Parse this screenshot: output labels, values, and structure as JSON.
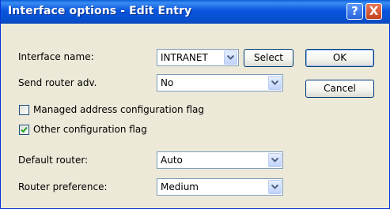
{
  "window": {
    "title": "Interface options - Edit Entry",
    "help_icon": "?",
    "close_icon": "X"
  },
  "form": {
    "interface_name": {
      "label": "Interface name:",
      "value": "INTRANET",
      "select_label": "Select"
    },
    "send_router_adv": {
      "label": "Send router adv.",
      "value": "No"
    },
    "managed_flag": {
      "label": "Managed address configuration flag",
      "checked": false
    },
    "other_flag": {
      "label": "Other configuration flag",
      "checked": true
    },
    "default_router": {
      "label": "Default router:",
      "value": "Auto"
    },
    "router_preference": {
      "label": "Router preference:",
      "value": "Medium"
    }
  },
  "buttons": {
    "ok": "OK",
    "cancel": "Cancel"
  },
  "colors": {
    "titlebar": "#0855dd",
    "dialog_bg": "#ece9d8",
    "check_mark": "#21a121"
  }
}
